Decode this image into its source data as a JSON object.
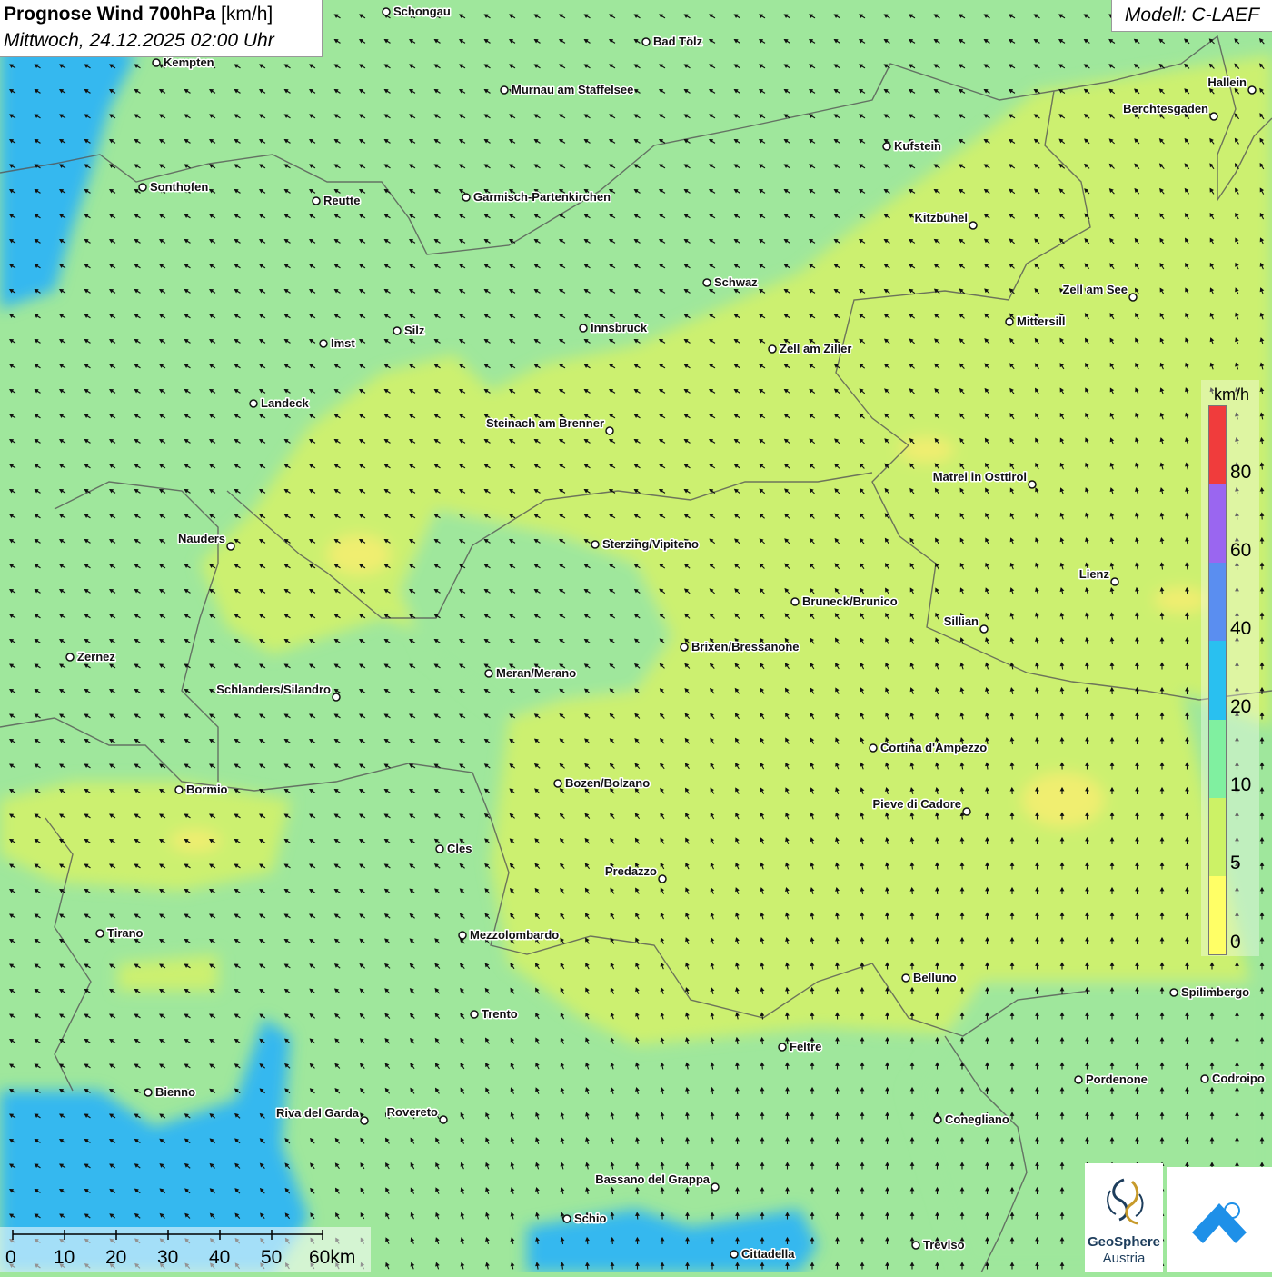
{
  "header": {
    "title_bold": "Prognose Wind 700hPa",
    "title_unit": " [km/h]",
    "datetime": "Mittwoch, 24.12.2025 02:00 Uhr",
    "model": "Modell: C-LAEF"
  },
  "legend": {
    "unit": "km/h",
    "bands": [
      {
        "from": 0,
        "to": 5,
        "color": "#ffff66"
      },
      {
        "from": 5,
        "to": 10,
        "color": "#ccf266"
      },
      {
        "from": 10,
        "to": 20,
        "color": "#80f0a0"
      },
      {
        "from": 20,
        "to": 40,
        "color": "#29c0f0"
      },
      {
        "from": 40,
        "to": 60,
        "color": "#5a8ef0"
      },
      {
        "from": 60,
        "to": 80,
        "color": "#9a66f0"
      },
      {
        "from": 80,
        "to": 100,
        "color": "#f03c3c"
      }
    ],
    "ticks": [
      "0",
      "5",
      "10",
      "20",
      "40",
      "60",
      "80"
    ]
  },
  "scale": {
    "labels": [
      "0",
      "10",
      "20",
      "30",
      "40",
      "50",
      "60km"
    ]
  },
  "branding": {
    "logo_text_1": "GeoSphere",
    "logo_text_2": "Austria",
    "logo_icon_1": "geosphere-logo-icon",
    "logo_icon_2": "cloud-arrow-logo-icon"
  },
  "cities": [
    {
      "name": "Schongau"
    },
    {
      "name": "Bad Tölz"
    },
    {
      "name": "Kempten"
    },
    {
      "name": "Murnau am Staffelsee"
    },
    {
      "name": "Hallein"
    },
    {
      "name": "Berchtesgaden"
    },
    {
      "name": "Kufstein"
    },
    {
      "name": "Sonthofen"
    },
    {
      "name": "Reutte"
    },
    {
      "name": "Garmisch-Partenkirchen"
    },
    {
      "name": "Kitzbühel"
    },
    {
      "name": "Schwaz"
    },
    {
      "name": "Zell am See"
    },
    {
      "name": "Mittersill"
    },
    {
      "name": "Innsbruck"
    },
    {
      "name": "Silz"
    },
    {
      "name": "Imst"
    },
    {
      "name": "Zell am Ziller"
    },
    {
      "name": "Landeck"
    },
    {
      "name": "Steinach am Brenner"
    },
    {
      "name": "Matrei in Osttirol"
    },
    {
      "name": "Nauders"
    },
    {
      "name": "Sterzing/Vipiteno"
    },
    {
      "name": "Lienz"
    },
    {
      "name": "Bruneck/Brunico"
    },
    {
      "name": "Sillian"
    },
    {
      "name": "Zernez"
    },
    {
      "name": "Brixen/Bressanone"
    },
    {
      "name": "Meran/Merano"
    },
    {
      "name": "Schlanders/Silandro"
    },
    {
      "name": "Cortina d'Ampezzo"
    },
    {
      "name": "Bozen/Bolzano"
    },
    {
      "name": "Bormio"
    },
    {
      "name": "Pieve di Cadore"
    },
    {
      "name": "Cles"
    },
    {
      "name": "Predazzo"
    },
    {
      "name": "Tirano"
    },
    {
      "name": "Mezzolombardo"
    },
    {
      "name": "Belluno"
    },
    {
      "name": "Spilimbergo"
    },
    {
      "name": "Trento"
    },
    {
      "name": "Feltre"
    },
    {
      "name": "Pordenone"
    },
    {
      "name": "Codroipo"
    },
    {
      "name": "Bienno"
    },
    {
      "name": "Riva del Garda"
    },
    {
      "name": "Rovereto"
    },
    {
      "name": "Conegliano"
    },
    {
      "name": "Bassano del Grappa"
    },
    {
      "name": "Schio"
    },
    {
      "name": "Treviso"
    },
    {
      "name": "Cittadella"
    }
  ]
}
